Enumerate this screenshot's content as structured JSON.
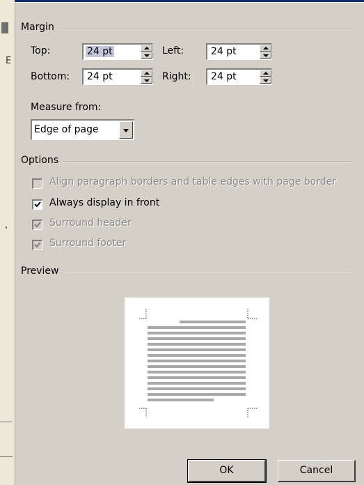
{
  "margin": {
    "group_label": "Margin",
    "top_label": "Top:",
    "top_value": "24 pt",
    "left_label": "Left:",
    "left_value": "24 pt",
    "bottom_label": "Bottom:",
    "bottom_value": "24 pt",
    "right_label": "Right:",
    "right_value": "24 pt"
  },
  "measure": {
    "label": "Measure from:",
    "selected": "Edge of page"
  },
  "options": {
    "group_label": "Options",
    "items": [
      {
        "label": "Align paragraph borders and table edges with page border",
        "checked": false,
        "enabled": false
      },
      {
        "label": "Always display in front",
        "checked": true,
        "enabled": true
      },
      {
        "label": "Surround header",
        "checked": true,
        "enabled": false
      },
      {
        "label": "Surround footer",
        "checked": true,
        "enabled": false
      }
    ]
  },
  "preview": {
    "group_label": "Preview"
  },
  "buttons": {
    "ok": "OK",
    "cancel": "Cancel"
  },
  "edge": {
    "letter": "E"
  },
  "colors": {
    "dialog_bg": "#d4d0c8",
    "title_bar": "#0f2d73",
    "preview_lines": "#a8a8a8"
  }
}
